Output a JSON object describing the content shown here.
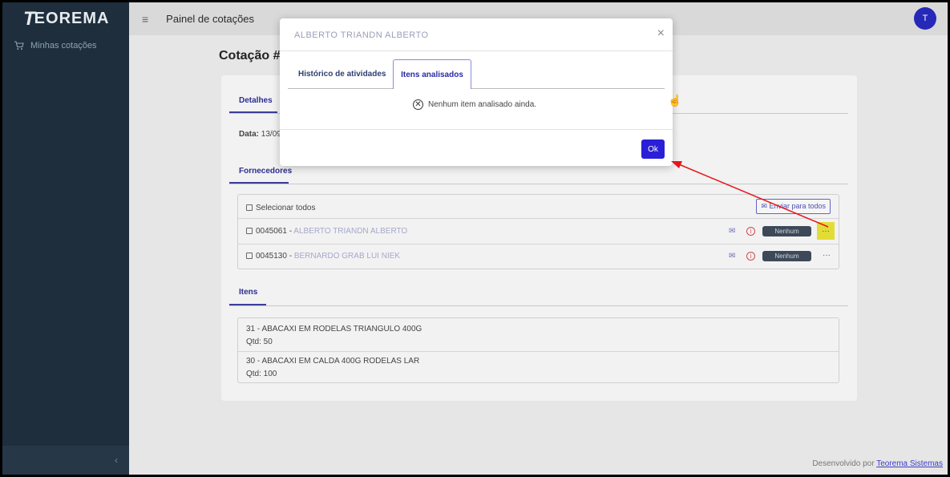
{
  "sidebar": {
    "logo_initial": "T",
    "logo_rest": "EOREMA",
    "items": [
      {
        "label": "Minhas cotações"
      }
    ],
    "collapse_glyph": "‹"
  },
  "topbar": {
    "menu_glyph": "≡",
    "title": "Painel de cotações",
    "avatar_letter": "T"
  },
  "page": {
    "title": "Cotação #",
    "tab_details": "Detalhes",
    "date_label": "Data:",
    "date_value": "13/09",
    "suppliers_tab": "Fornecedores",
    "select_all": "Selecionar todos",
    "send_all": "✉ Enviar para todos",
    "items_tab": "Itens"
  },
  "suppliers": [
    {
      "code": "0045061",
      "name": "ALBERTO TRIANDN ALBERTO",
      "status": "Nenhum"
    },
    {
      "code": "0045130",
      "name": "BERNARDO GRAB LUI NIEK",
      "status": "Nenhum"
    }
  ],
  "items": [
    {
      "desc": "31 - ABACAXI EM RODELAS TRIANGULO 400G",
      "qty": "Qtd: 50"
    },
    {
      "desc": "30 - ABACAXI EM CALDA 400G RODELAS LAR",
      "qty": "Qtd: 100"
    }
  ],
  "footer": {
    "text": "Desenvolvido por ",
    "link": "Teorema Sistemas"
  },
  "modal": {
    "title": "ALBERTO TRIANDN ALBERTO",
    "close_glyph": "×",
    "tabs": [
      {
        "label": "Histórico de atividades"
      },
      {
        "label": "Itens analisados",
        "active": true
      }
    ],
    "empty_glyph": "✕",
    "empty_message": "Nenhum item analisado ainda.",
    "ok_label": "Ok"
  },
  "annotation": {
    "arrow_color": "#e8151b",
    "highlight_color": "#e2dc36"
  }
}
